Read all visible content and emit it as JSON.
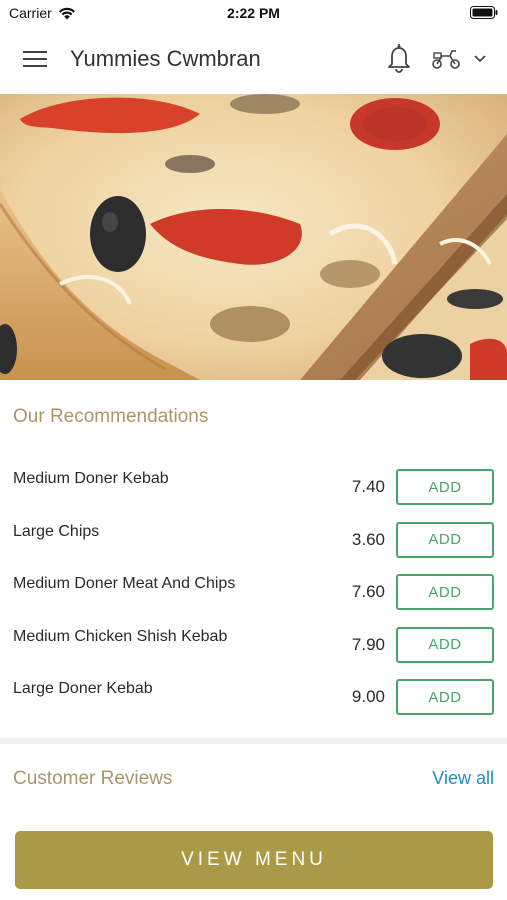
{
  "status_bar": {
    "carrier": "Carrier",
    "time": "2:22 PM"
  },
  "header": {
    "title": "Yummies Cwmbran",
    "icons": [
      "hamburger-menu-icon",
      "bell-icon",
      "delivery-scooter-icon",
      "chevron-down-icon"
    ]
  },
  "hero": {
    "description_icon": "pizza-photo"
  },
  "recommendations": {
    "title": "Our Recommendations",
    "add_label": "ADD",
    "items": [
      {
        "name": "Medium Doner Kebab",
        "price": "7.40"
      },
      {
        "name": "Large Chips",
        "price": "3.60"
      },
      {
        "name": "Medium Doner Meat And Chips",
        "price": "7.60"
      },
      {
        "name": "Medium Chicken Shish Kebab",
        "price": "7.90"
      },
      {
        "name": "Large Doner Kebab",
        "price": "9.00"
      }
    ]
  },
  "reviews": {
    "title": "Customer Reviews",
    "view_all": "View all"
  },
  "footer": {
    "view_menu": "VIEW MENU"
  },
  "colors": {
    "accent_gold": "#aa9a47",
    "section_title": "#a8976a",
    "add_green": "#4aa46a",
    "link_blue": "#1e8fc9"
  }
}
